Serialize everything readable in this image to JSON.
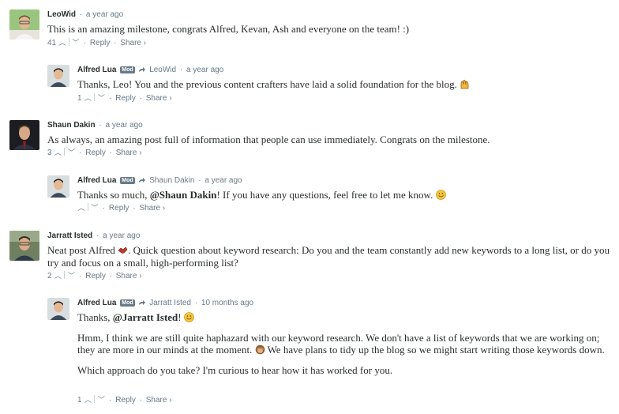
{
  "comments": [
    {
      "author": "LeoWid",
      "time": "a year ago",
      "text": "This is an amazing milestone, congrats Alfred, Kevan, Ash and everyone on the team! :)",
      "votes": "41",
      "reply": "Reply",
      "share": "Share ›"
    },
    {
      "author": "Alfred Lua",
      "badge": "Mod",
      "reply_to": "LeoWid",
      "time": "a year ago",
      "text": "Thanks, Leo! You and the previous content crafters have laid a solid foundation for the blog.",
      "votes": "1",
      "reply": "Reply",
      "share": "Share ›"
    },
    {
      "author": "Shaun Dakin",
      "time": "a year ago",
      "text": "As always, an amazing post full of information that people can use immediately. Congrats on the milestone.",
      "votes": "3",
      "reply": "Reply",
      "share": "Share ›"
    },
    {
      "author": "Alfred Lua",
      "badge": "Mod",
      "reply_to": "Shaun Dakin",
      "time": "a year ago",
      "text_before": "Thanks so much, ",
      "mention": "@Shaun Dakin",
      "text_after": "! If you have any questions, feel free to let me know.",
      "votes": "",
      "reply": "Reply",
      "share": "Share ›"
    },
    {
      "author": "Jarratt Isted",
      "time": "a year ago",
      "text_before": "Neat post Alfred ",
      "text_after": ". Quick question about keyword research: Do you and the team constantly add new keywords to a long list, or do you try and focus on a small, high-performing list?",
      "votes": "2",
      "reply": "Reply",
      "share": "Share ›"
    },
    {
      "author": "Alfred Lua",
      "badge": "Mod",
      "reply_to": "Jarratt Isted",
      "time": "10 months ago",
      "text_before": "Thanks, ",
      "mention": "@Jarratt Isted",
      "text_after": "!",
      "paragraph2_before": "Hmm, I think we are still quite haphazard with our keyword research. We don't have a list of keywords that we are working on; they are more in our minds at the moment.",
      "paragraph2_after": " We have plans to tidy up the blog so we might start writing those keywords down.",
      "paragraph3": "Which approach do you take? I'm curious to hear how it has worked for you.",
      "votes": "1",
      "reply": "Reply",
      "share": "Share ›"
    }
  ],
  "vote_up": "^",
  "vote_down": "v",
  "dot": "·",
  "colors": {
    "text": "#2a2e2e",
    "meta": "#687a86",
    "badge": "#687a86"
  },
  "icons": [
    "reply-arrow-icon",
    "raised-hands-emoji",
    "smiley-emoji",
    "handshake-emoji",
    "see-no-evil-monkey-emoji",
    "upvote-icon",
    "downvote-icon"
  ]
}
